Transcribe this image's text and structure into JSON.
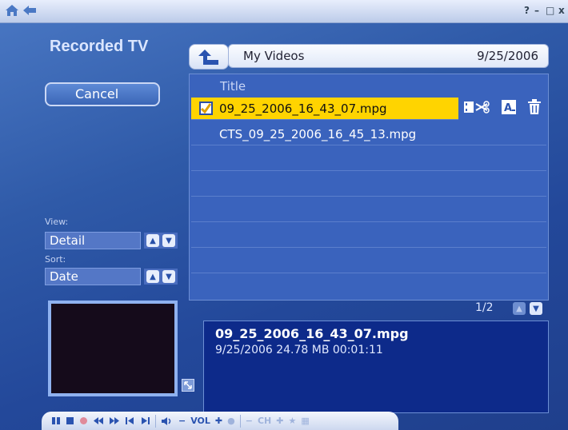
{
  "titlebar": {
    "home_icon": "home-icon",
    "back_icon": "back-arrow-icon",
    "help": "?",
    "minimize": "–",
    "maximize": "□",
    "close": "x"
  },
  "section_title": "Recorded TV",
  "cancel_label": "Cancel",
  "path": {
    "folder": "My Videos",
    "date": "9/25/2006"
  },
  "list": {
    "column_title": "Title",
    "rows": [
      {
        "name": "09_25_2006_16_43_07.mpg",
        "selected": true,
        "checked": true
      },
      {
        "name": "CTS_09_25_2006_16_45_13.mpg",
        "selected": false,
        "checked": false
      }
    ],
    "row_actions": [
      "edit-video-icon",
      "rename-icon",
      "delete-icon"
    ]
  },
  "pager": {
    "text": "1/2"
  },
  "view": {
    "label": "View:",
    "value": "Detail"
  },
  "sort": {
    "label": "Sort:",
    "value": "Date"
  },
  "info": {
    "name": "09_25_2006_16_43_07.mpg",
    "meta": "9/25/2006  24.78 MB  00:01:11"
  },
  "transport": {
    "vol_label": "VOL",
    "ch_label": "CH",
    "buttons": [
      "pause-icon",
      "stop-icon",
      "record-icon",
      "rewind-icon",
      "fast-forward-icon",
      "skip-back-icon",
      "skip-forward-icon"
    ]
  },
  "colors": {
    "selection": "#ffd400",
    "info_panel": "#0d2a8a"
  }
}
